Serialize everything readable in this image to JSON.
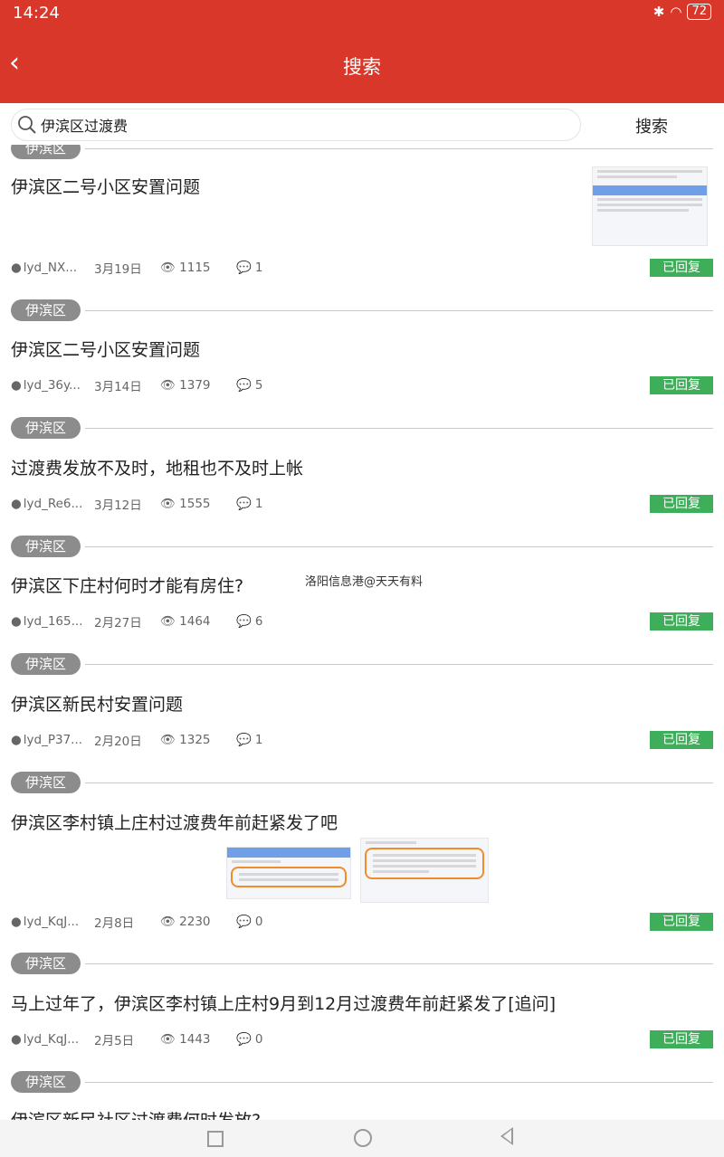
{
  "status_bar": {
    "time": "14:24",
    "battery": "72"
  },
  "header": {
    "title": "搜索",
    "back_icon": "chevron-left-icon"
  },
  "search": {
    "value": "伊滨区过渡费",
    "button": "搜索"
  },
  "items": [
    {
      "tag": "伊滨区",
      "title": "伊滨区二号小区安置问题",
      "user": "lyd_NX...",
      "date": "3月19日",
      "views": "1115",
      "comments": "1",
      "status": "已回复"
    },
    {
      "tag": "伊滨区",
      "title": "伊滨区二号小区安置问题",
      "user": "lyd_36y...",
      "date": "3月14日",
      "views": "1379",
      "comments": "5",
      "status": "已回复"
    },
    {
      "tag": "伊滨区",
      "title": "过渡费发放不及时，地租也不及时上帐",
      "user": "lyd_Re6...",
      "date": "3月12日",
      "views": "1555",
      "comments": "1",
      "status": "已回复"
    },
    {
      "tag": "伊滨区",
      "title": "伊滨区下庄村何时才能有房住?",
      "user": "lyd_165...",
      "date": "2月27日",
      "views": "1464",
      "comments": "6",
      "status": "已回复"
    },
    {
      "tag": "伊滨区",
      "title": "伊滨区新民村安置问题",
      "user": "lyd_P37...",
      "date": "2月20日",
      "views": "1325",
      "comments": "1",
      "status": "已回复"
    },
    {
      "tag": "伊滨区",
      "title": "伊滨区李村镇上庄村过渡费年前赶紧发了吧",
      "user": "lyd_KqJ...",
      "date": "2月8日",
      "views": "2230",
      "comments": "0",
      "status": "已回复"
    },
    {
      "tag": "伊滨区",
      "title": "马上过年了，伊滨区李村镇上庄村9月到12月过渡费年前赶紧发了[追问]",
      "user": "lyd_KqJ...",
      "date": "2月5日",
      "views": "1443",
      "comments": "0",
      "status": "已回复"
    },
    {
      "tag": "伊滨区",
      "title": "伊滨区新民社区过渡费何时发放?"
    }
  ],
  "watermark": "洛阳信息港@天天有料"
}
